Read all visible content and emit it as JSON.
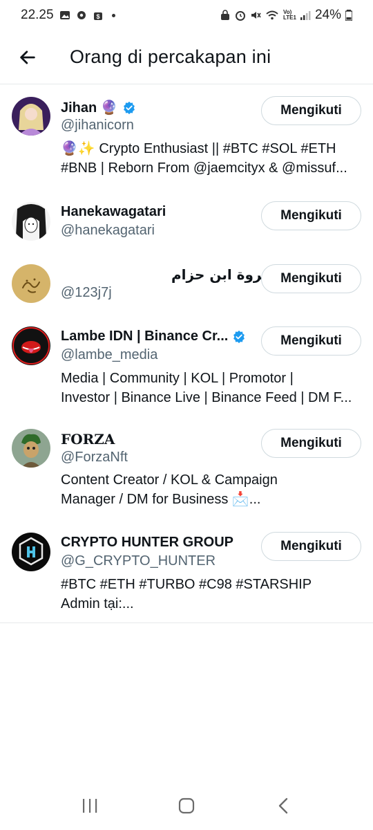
{
  "status_bar": {
    "time": "22.25",
    "battery": "24%",
    "network_label": "Vo) LTE1"
  },
  "header": {
    "title": "Orang di percakapan ini",
    "back_icon": "arrow-left-icon"
  },
  "users": [
    {
      "name": "Jihan 🔮",
      "handle": "@jihanicorn",
      "verified": true,
      "bio": "🔮✨ Crypto Enthusiast || #BTC #SOL #ETH\n#BNB | Reborn From @jaemcityx & @missuf...",
      "button": "Mengikuti"
    },
    {
      "name": "Hanekawagatari",
      "handle": "@hanekagatari",
      "verified": false,
      "bio": "",
      "button": "Mengikuti"
    },
    {
      "name": "عروة ابن حزام",
      "handle": "@123j7j",
      "verified": false,
      "bio": "",
      "button": "Mengikuti"
    },
    {
      "name": "Lambe IDN | Binance Cr...",
      "handle": "@lambe_media",
      "verified": true,
      "bio": "Media | Community | KOL | Promotor |\nInvestor | Binance Live | Binance Feed | DM F...",
      "button": "Mengikuti"
    },
    {
      "name": "FORZA",
      "handle": "@ForzaNft",
      "verified": false,
      "bio": "Content Creator / KOL & Campaign\nManager / DM for Business 📩...",
      "button": "Mengikuti"
    },
    {
      "name": "CRYPTO HUNTER GROUP",
      "handle": "@G_CRYPTO_HUNTER",
      "verified": false,
      "bio": "#BTC #ETH #TURBO #C98 #STARSHIP\nAdmin tại:...",
      "button": "Mengikuti"
    }
  ],
  "nav": {
    "recent_icon": "recent-apps-icon",
    "home_icon": "home-icon",
    "back_icon": "nav-back-icon"
  },
  "colors": {
    "verified": "#1d9bf0",
    "handle": "#536471",
    "text": "#0f1419",
    "border": "#cfd9de"
  }
}
